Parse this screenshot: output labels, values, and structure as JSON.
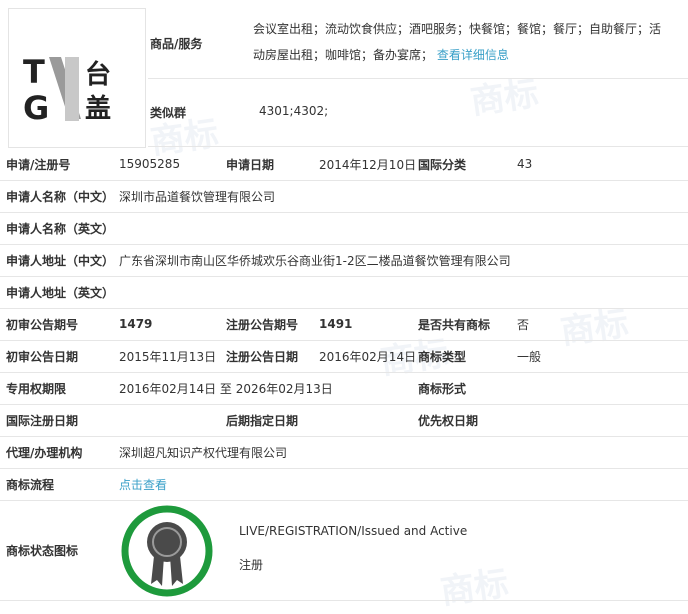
{
  "logo": {
    "alt": "TNGN 台盖 logo"
  },
  "goods": {
    "label": "商品/服务",
    "text": "会议室出租；流动饮食供应；酒吧服务；快餐馆；餐馆；餐厅；自助餐厅；活动房屋出租；咖啡馆；备办宴席；",
    "link": "查看详细信息"
  },
  "similar_group": {
    "label": "类似群",
    "value": "4301;4302;"
  },
  "fields": {
    "reg_no_label": "申请/注册号",
    "reg_no": "15905285",
    "apply_date_label": "申请日期",
    "apply_date": "2014年12月10日",
    "intl_class_label": "国际分类",
    "intl_class": "43",
    "applicant_cn_label": "申请人名称（中文）",
    "applicant_cn": "深圳市品道餐饮管理有限公司",
    "applicant_en_label": "申请人名称（英文）",
    "applicant_en": "",
    "address_cn_label": "申请人地址（中文）",
    "address_cn": "广东省深圳市南山区华侨城欢乐谷商业街1-2区二楼品道餐饮管理有限公司",
    "address_en_label": "申请人地址（英文）",
    "address_en": "",
    "prelim_pub_no_label": "初审公告期号",
    "prelim_pub_no": "1479",
    "reg_pub_no_label": "注册公告期号",
    "reg_pub_no": "1491",
    "shared_label": "是否共有商标",
    "shared": "否",
    "prelim_pub_date_label": "初审公告日期",
    "prelim_pub_date": "2015年11月13日",
    "reg_pub_date_label": "注册公告日期",
    "reg_pub_date": "2016年02月14日",
    "tm_type_label": "商标类型",
    "tm_type": "一般",
    "exclusive_period_label": "专用权期限",
    "exclusive_period": "2016年02月14日 至 2026年02月13日",
    "tm_form_label": "商标形式",
    "tm_form": "",
    "intl_reg_date_label": "国际注册日期",
    "intl_reg_date": "",
    "later_designation_label": "后期指定日期",
    "later_designation": "",
    "priority_date_label": "优先权日期",
    "priority_date": "",
    "agent_label": "代理/办理机构",
    "agent": "深圳超凡知识产权代理有限公司",
    "process_label": "商标流程",
    "process_link": "点击查看",
    "status_icon_label": "商标状态图标",
    "status_en": "LIVE/REGISTRATION/Issued and Active",
    "status_cn": "注册"
  },
  "watermark": "商标",
  "colors": {
    "link": "#3aa0c8",
    "badge_ring": "#1e9a3c",
    "badge_medal": "#4a4a4a",
    "border": "#e6e6e6"
  }
}
